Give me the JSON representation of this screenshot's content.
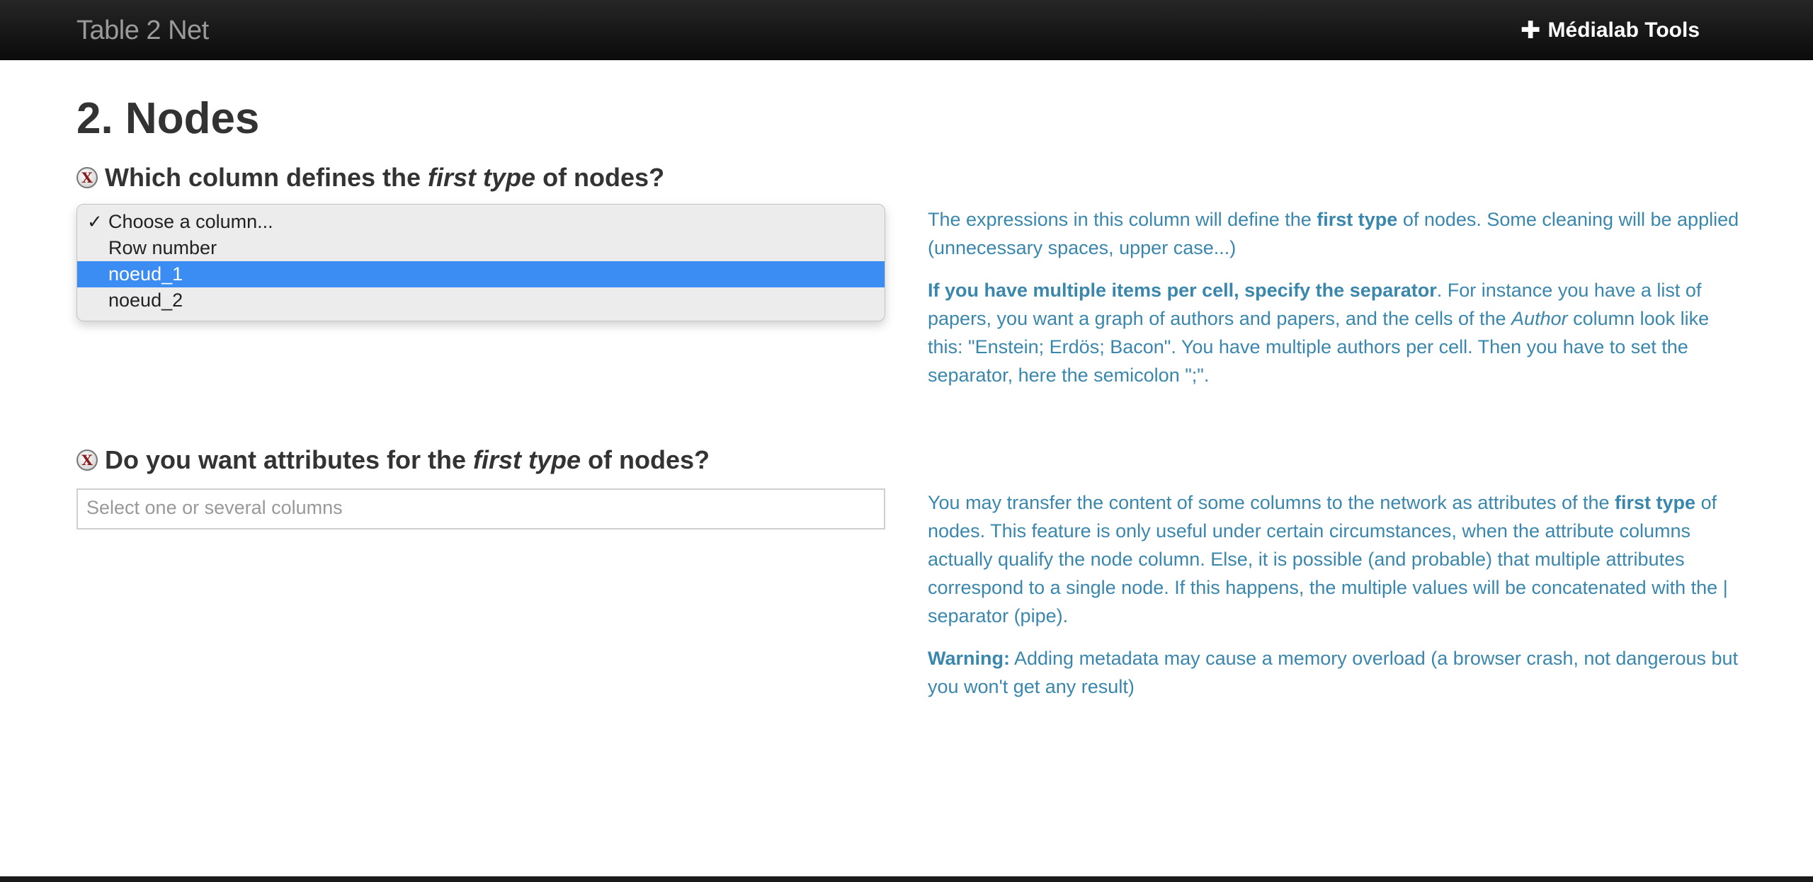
{
  "navbar": {
    "brand": "Table 2 Net",
    "tools_icon": "plus-icon",
    "tools_label": "Médialab Tools"
  },
  "page": {
    "title": "2. Nodes"
  },
  "question1": {
    "icon": "x-icon",
    "prefix": "Which column defines the ",
    "emphasis": "first type",
    "suffix": " of nodes?",
    "options": [
      {
        "label": "Choose a column...",
        "checked": true
      },
      {
        "label": "Row number"
      },
      {
        "label": "noeud_1",
        "highlighted": true
      },
      {
        "label": "noeud_2"
      }
    ],
    "help": {
      "p1_a": "The expressions in this column will define the ",
      "p1_b": "first type",
      "p1_c": " of nodes. Some cleaning will be applied (unnecessary spaces, upper case...)",
      "p2_a": "If you have multiple items per cell, specify the separator",
      "p2_b": ". For instance you have a list of papers, you want a graph of authors and papers, and the cells of the ",
      "p2_c": "Author",
      "p2_d": " column look like this: \"Enstein; Erdös; Bacon\". You have multiple authors per cell. Then you have to set the separator, here the semicolon \";\"."
    }
  },
  "question2": {
    "icon": "x-icon",
    "prefix": "Do you want attributes for the ",
    "emphasis": "first type",
    "suffix": " of nodes?",
    "placeholder": "Select one or several columns",
    "help": {
      "p1_a": "You may transfer the content of some columns to the network as attributes of the ",
      "p1_b": "first type",
      "p1_c": " of nodes. This feature is only useful under certain circumstances, when the attribute columns actually qualify the node column. Else, it is possible (and probable) that multiple attributes correspond to a single node. If this happens, the multiple values will be concatenated with the | separator (pipe).",
      "p2_a": "Warning:",
      "p2_b": " Adding metadata may cause a memory overload (a browser crash, not dangerous but you won't get any result)"
    }
  },
  "colors": {
    "navbar_bg": "#111111",
    "help_text": "#3a87ad",
    "selected_option": "#3b8df3"
  }
}
